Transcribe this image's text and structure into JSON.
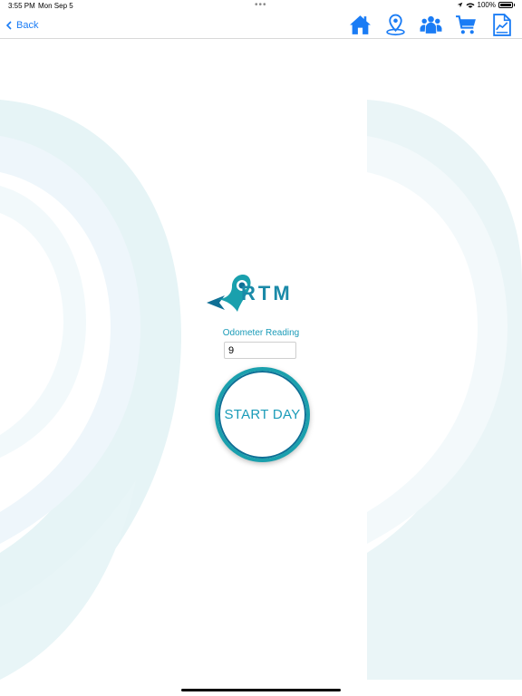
{
  "status_bar": {
    "time": "3:55 PM",
    "date": "Mon Sep 5",
    "dots": "•••",
    "battery": "100%"
  },
  "nav": {
    "back_label": "Back",
    "icons": [
      "home-icon",
      "location-pin-icon",
      "group-icon",
      "cart-icon",
      "report-icon"
    ],
    "icon_color": "#1a7cf5"
  },
  "logo": {
    "text": "RTM"
  },
  "odometer": {
    "label": "Odometer Reading",
    "value": "9"
  },
  "start_button": {
    "label": "START DAY"
  },
  "colors": {
    "accent": "#1a9bb8",
    "nav_blue": "#1a7cf5",
    "swirl": "#dff0f4"
  }
}
